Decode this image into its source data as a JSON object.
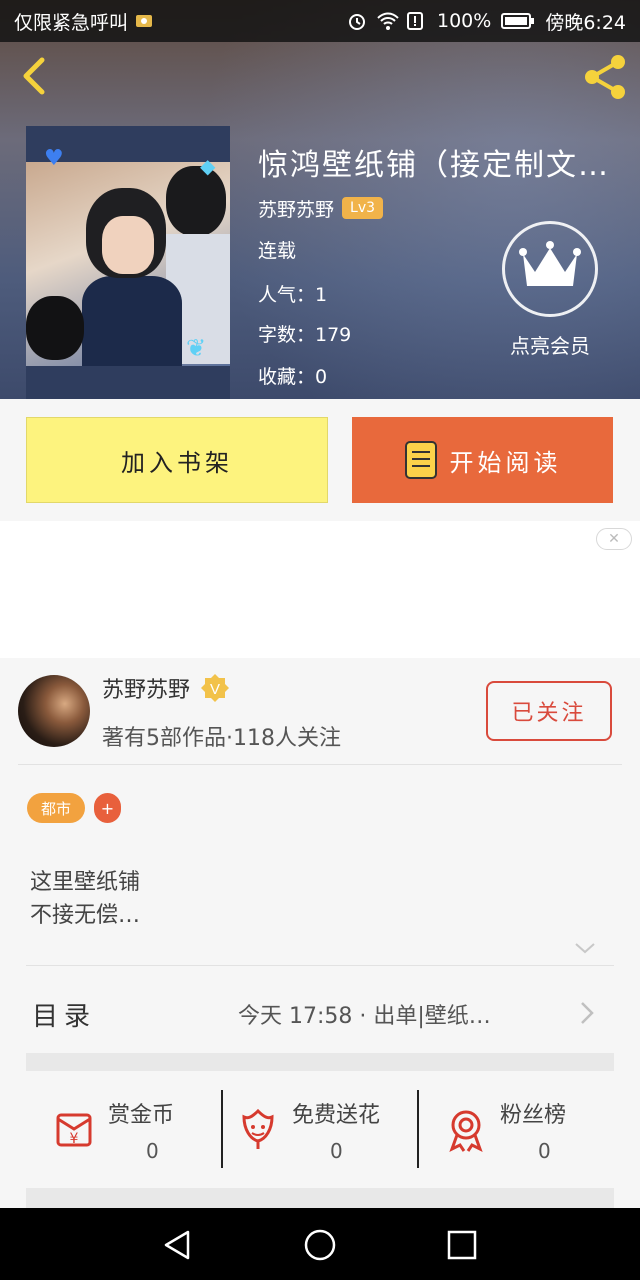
{
  "status_bar": {
    "carrier": "仅限紧急呼叫",
    "battery": "100%",
    "time": "傍晚6:24"
  },
  "book": {
    "title": "惊鸿壁纸铺（接定制文…",
    "author": "苏野苏野",
    "level": "Lv3",
    "status": "连载",
    "popularity": "人气：1",
    "word_count": "字数：179",
    "favorites": "收藏：0"
  },
  "vip": {
    "label": "点亮会员"
  },
  "actions": {
    "add_shelf": "加入书架",
    "start_read": "开始阅读"
  },
  "ad": {
    "close": "✕"
  },
  "author_card": {
    "name": "苏野苏野",
    "stats": "著有5部作品·118人关注",
    "follow": "已关注"
  },
  "tags": {
    "primary": "都市",
    "add": "+"
  },
  "description": {
    "line1": "这里壁纸铺",
    "line2": "不接无偿…"
  },
  "toc": {
    "label": "目录",
    "latest": "今天 17:58 · 出单|壁纸…"
  },
  "stats": [
    {
      "label": "赏金币",
      "value": "0",
      "icon": "reward-coin-icon"
    },
    {
      "label": "免费送花",
      "value": "0",
      "icon": "flower-icon"
    },
    {
      "label": "粉丝榜",
      "value": "0",
      "icon": "ribbon-medal-icon"
    }
  ],
  "colors": {
    "accent": "#e8693c",
    "shelf_yellow": "#fdf37e",
    "tag_orange": "#f2a23f",
    "follow_red": "#d94a3c"
  }
}
